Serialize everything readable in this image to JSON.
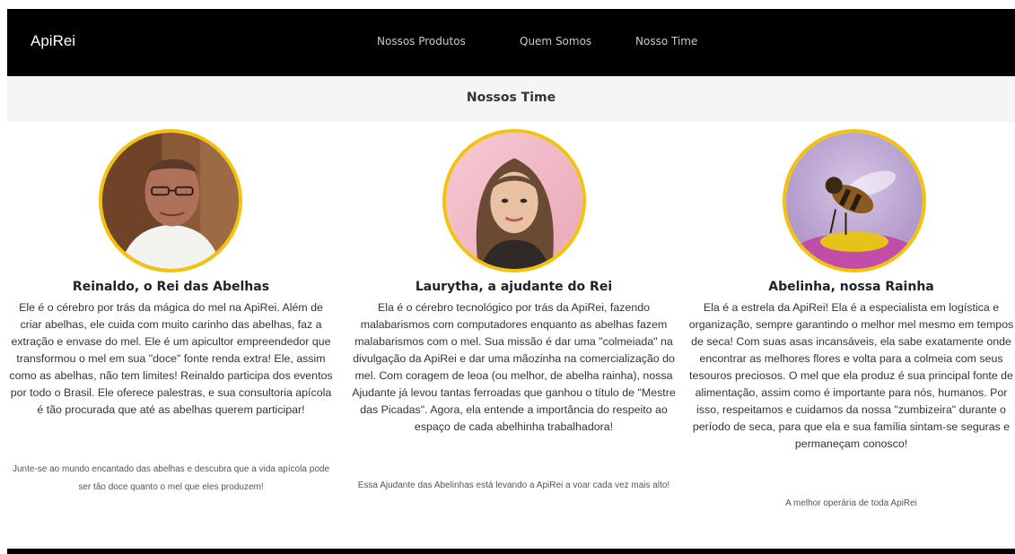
{
  "navbar": {
    "brand": "ApiRei",
    "links": [
      "Nossos Produtos",
      "Quem Somos",
      "Nosso Time"
    ]
  },
  "subheader": {
    "title": "Nossos Time"
  },
  "team": [
    {
      "name": "Reinaldo, o Rei das Abelhas",
      "description": "Ele é o cérebro por trás da mágica do mel na ApiRei. Além de criar abelhas, ele cuida com muito carinho das abelhas, faz a extração e envase do mel. Ele é um apicultor empreendedor que transformou o mel em sua \"doce\" fonte renda extra! Ele, assim como as abelhas, não tem limites! Reinaldo participa dos eventos por todo o Brasil. Ele oferece palestras, e sua consultoria apícola é tão procurada que até as abelhas querem participar!",
      "note": "Junte-se ao mundo encantado das abelhas e descubra que a vida apícola pode ser tão doce quanto o mel que eles produzem!"
    },
    {
      "name": "Laurytha, a ajudante do Rei",
      "description": "Ela é o cérebro tecnológico por trás da ApiRei, fazendo malabarismos com computadores enquanto as abelhas fazem malabarismos com o mel. Sua missão é dar uma \"colmeiada\" na divulgação da ApiRei e dar uma mãozinha na comercialização do mel. Com coragem de leoa (ou melhor, de abelha rainha), nossa Ajudante já levou tantas ferroadas que ganhou o título de \"Mestre das Picadas\". Agora, ela entende a importância do respeito ao espaço de cada abelhinha trabalhadora!",
      "note": "Essa Ajudante das Abelinhas está levando a ApiRei a voar cada vez mais alto!"
    },
    {
      "name": "Abelinha, nossa Rainha",
      "description": "Ela é a estrela da ApiRei! Ela é a especialista em logística e organização, sempre garantindo o melhor mel mesmo em tempos de seca! Com suas asas incansáveis, ela sabe exatamente onde encontrar as melhores flores e volta para a colmeia com seus tesouros preciosos. O mel que ela produz é sua principal fonte de alimentação, assim como é importante para nós, humanos. Por isso, respeitamos e cuidamos da nossa \"zumbizeira\" durante o período de seca, para que ela e sua família sintam-se seguras e permaneçam conosco!",
      "note": "A melhor operária de toda ApiRei"
    }
  ],
  "colors": {
    "navbar_bg": "#000000",
    "avatar_border": "#f4c20d",
    "subheader_bg": "#f5f5f5"
  }
}
